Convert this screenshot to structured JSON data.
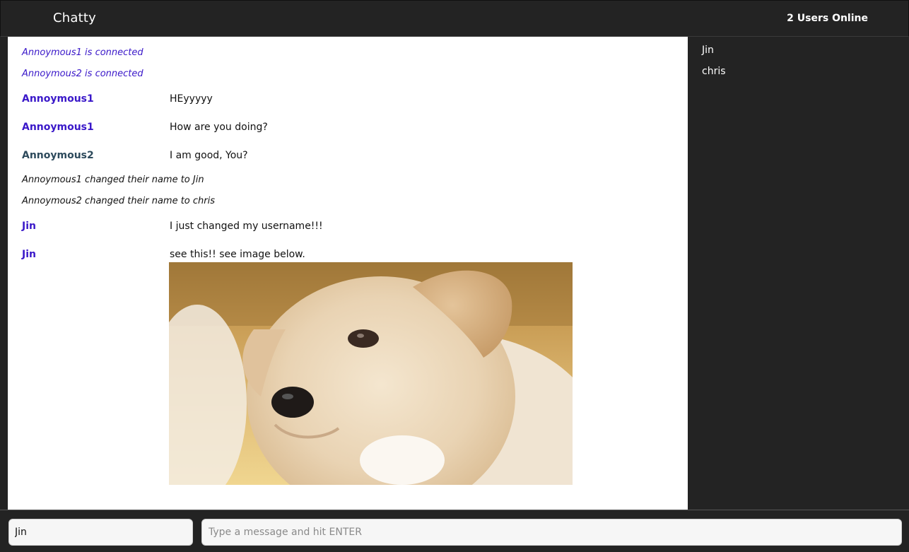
{
  "header": {
    "app_title": "Chatty",
    "online_status": "2 Users Online"
  },
  "sidebar": {
    "users": [
      "Jin",
      "chris"
    ]
  },
  "messages": {
    "system": [
      "Annoymous1 is connected",
      "Annoymous2 is connected",
      "Annoymous1 changed their name to Jin",
      "Annoymous2 changed their name to chris"
    ],
    "chat": [
      {
        "user": "Annoymous1",
        "text": "HEyyyyy"
      },
      {
        "user": "Annoymous1",
        "text": "How are you doing?"
      },
      {
        "user": "Annoymous2",
        "text": "I am good, You?"
      },
      {
        "user": "Jin",
        "text": "I just changed my username!!!"
      },
      {
        "user": "Jin",
        "text": "see this!! see image below."
      }
    ],
    "image": {
      "subject": "puppy-photo"
    }
  },
  "composer": {
    "username_value": "Jin",
    "message_placeholder": "Type a message and hit ENTER"
  },
  "colors": {
    "bar_background": "#232323",
    "user_color_1": "#3a18c9",
    "user_color_2": "#2d4a5c"
  }
}
